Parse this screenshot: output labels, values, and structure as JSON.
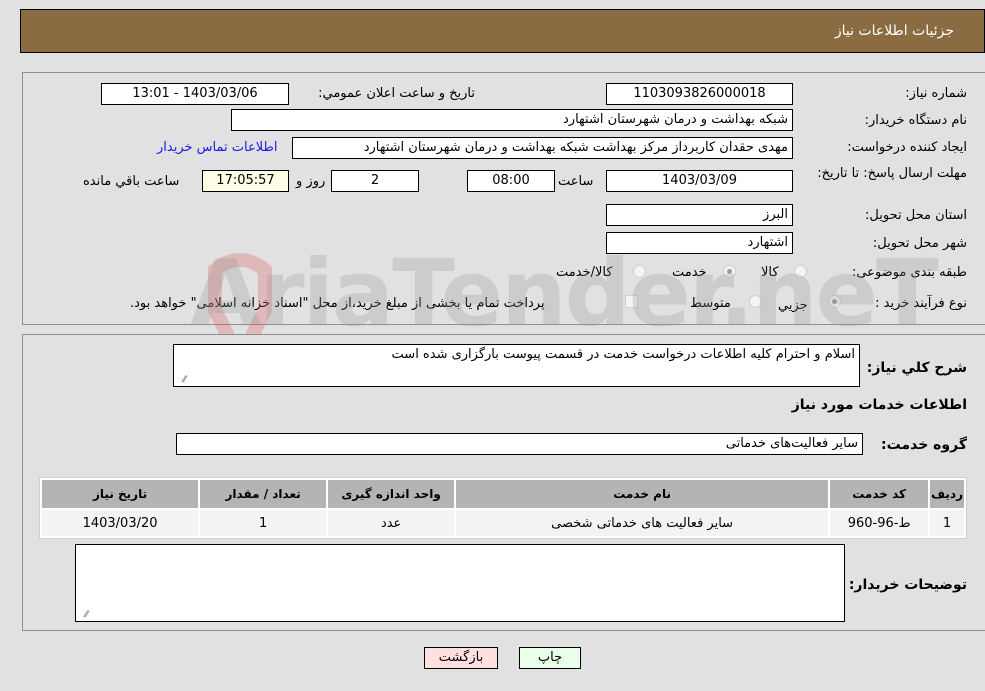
{
  "header": {
    "title": "جزئیات اطلاعات نیاز"
  },
  "form": {
    "need_number": {
      "label": "شماره نیاز:",
      "value": "1103093826000018"
    },
    "announce_datetime": {
      "label": "تاریخ و ساعت اعلان عمومي:",
      "value": "1403/03/06 - 13:01"
    },
    "buyer_org": {
      "label": "نام دستگاه خریدار:",
      "value": "شبکه بهداشت و درمان شهرستان اشتهارد"
    },
    "requester": {
      "label": "ایجاد کننده درخواست:",
      "value": "مهدی حقدان کاربرداز مرکز بهداشت شبکه بهداشت و درمان شهرستان اشتهارد",
      "contact_link": "اطلاعات تماس خریدار"
    },
    "deadline": {
      "label": "مهلت ارسال پاسخ: تا تاریخ:",
      "date": "1403/03/09",
      "time_label": "ساعت",
      "time": "08:00",
      "days": "2",
      "days_label": "روز و",
      "remaining": "17:05:57",
      "remaining_label": "ساعت باقي مانده"
    },
    "province": {
      "label": "استان محل تحویل:",
      "value": "البرز"
    },
    "city": {
      "label": "شهر محل تحویل:",
      "value": "اشتهارد"
    },
    "category": {
      "label": "طبقه بندی موضوعی:",
      "options": [
        {
          "label": "کالا",
          "checked": false
        },
        {
          "label": "خدمت",
          "checked": true
        },
        {
          "label": "کالا/خدمت",
          "checked": false
        }
      ]
    },
    "purchase_type": {
      "label": "نوع فرآیند خرید :",
      "options": [
        {
          "label": "جزيي",
          "checked": true
        },
        {
          "label": "متوسط",
          "checked": false
        }
      ],
      "treasury_checkbox_label": "پرداخت تمام یا بخشی از مبلغ خرید،از محل \"اسناد خزانه اسلامی\" خواهد بود.",
      "treasury_checked": false
    }
  },
  "details": {
    "description_label": "شرح کلي نیاز:",
    "description": "اسلام و احترام کلیه اطلاعات درخواست خدمت در قسمت پیوست بارگزاری شده است",
    "services_heading": "اطلاعات خدمات مورد نیاز",
    "service_group_label": "گروه خدمت:",
    "service_group": "سایر فعالیت‌های خدماتی",
    "table": {
      "headers": [
        "ردیف",
        "کد خدمت",
        "نام خدمت",
        "واحد اندازه گیری",
        "تعداد / مقدار",
        "تاریخ نیاز"
      ],
      "rows": [
        [
          "1",
          "ط-96-960",
          "سایر فعالیت های خدماتی شخصی",
          "عدد",
          "1",
          "1403/03/20"
        ]
      ]
    },
    "buyer_notes_label": "توضیحات خریدار:",
    "buyer_notes": ""
  },
  "buttons": {
    "print": "چاپ",
    "back": "بازگشت"
  },
  "watermark": "AriaTender.neT",
  "colors": {
    "header_bg": "#8b6c42",
    "page_bg": "#e1e1e1",
    "back_btn": "#ffe0e0",
    "print_btn": "#eaffea",
    "link": "#1a1ae6"
  }
}
